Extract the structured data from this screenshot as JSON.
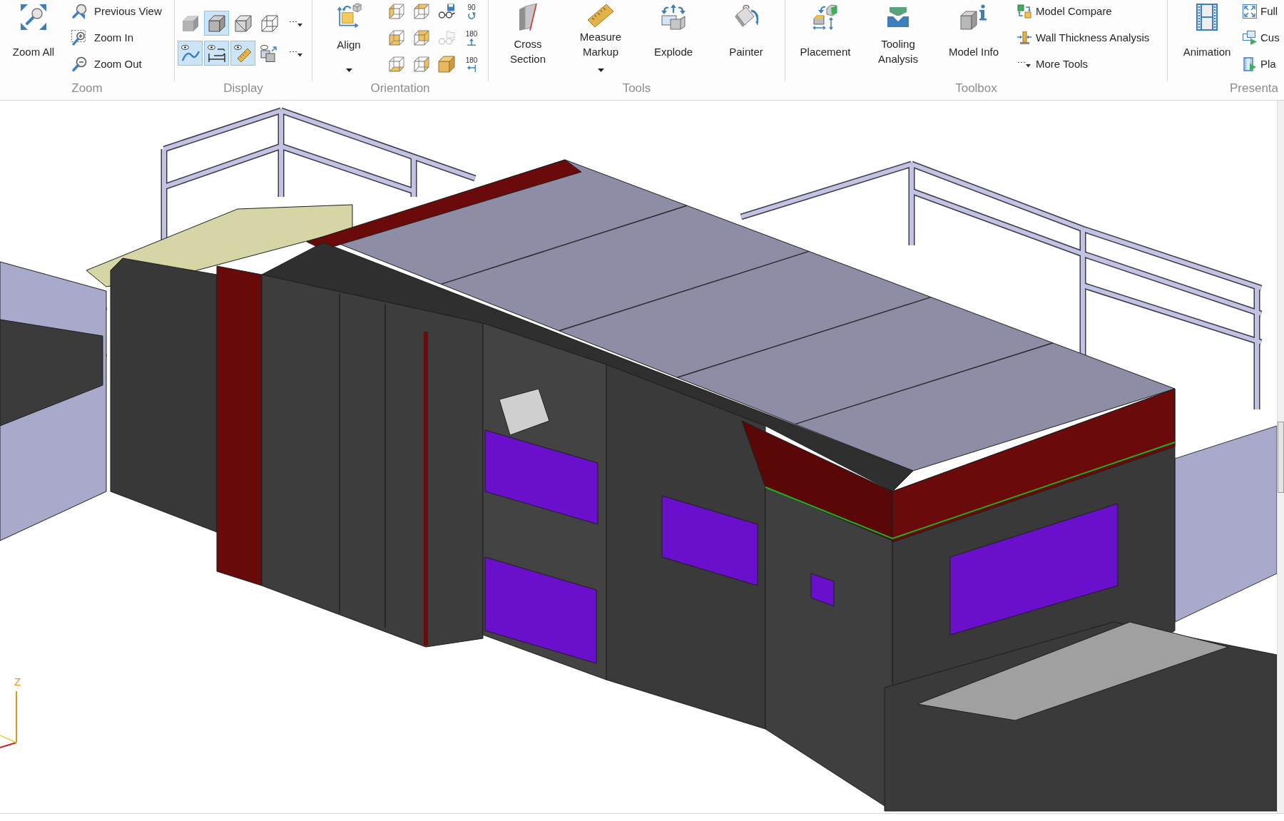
{
  "ribbon": {
    "zoom": {
      "label": "Zoom",
      "large": [
        {
          "label": "Zoom All",
          "menu": false
        }
      ],
      "small": [
        {
          "label": "Previous View"
        },
        {
          "label": "Zoom In"
        },
        {
          "label": "Zoom Out"
        }
      ]
    },
    "display": {
      "label": "Display",
      "buttons": [
        {
          "selected": false
        },
        {
          "selected": true
        },
        {
          "selected": false
        },
        {
          "selected": false
        },
        {
          "selected": false
        },
        {
          "selected": true
        },
        {
          "selected": true
        },
        {
          "selected": true
        },
        {
          "selected": false
        },
        {
          "selected": false
        }
      ]
    },
    "orientation": {
      "label": "Orientation",
      "large": [
        {
          "label": "Align",
          "menu": true
        }
      ],
      "view_buttons": [
        {
          "disabled": false
        },
        {
          "disabled": true
        },
        {
          "disabled": false
        }
      ],
      "rotate_buttons": [
        {
          "label": "90"
        },
        {
          "label": "180"
        },
        {
          "label": "180"
        }
      ]
    },
    "tools": {
      "label": "Tools",
      "large": [
        {
          "label": "Cross\nSection",
          "menu": false
        },
        {
          "label": "Measure\nMarkup",
          "menu": true
        },
        {
          "label": "Explode",
          "menu": false
        },
        {
          "label": "Painter",
          "menu": false
        }
      ]
    },
    "toolbox": {
      "label": "Toolbox",
      "large": [
        {
          "label": "Placement",
          "menu": false
        },
        {
          "label": "Tooling\nAnalysis",
          "menu": false
        },
        {
          "label": "Model Info",
          "menu": false
        }
      ],
      "small": [
        {
          "label": "Model Compare"
        },
        {
          "label": "Wall Thickness Analysis"
        },
        {
          "label": "More Tools"
        }
      ]
    },
    "presentation": {
      "label": "Presenta",
      "large": [
        {
          "label": "Animation",
          "menu": false
        }
      ],
      "small": [
        {
          "label": "Full"
        },
        {
          "label": "Cus"
        },
        {
          "label": "Pla"
        }
      ]
    }
  },
  "viewport": {
    "axis_label": "Z"
  }
}
